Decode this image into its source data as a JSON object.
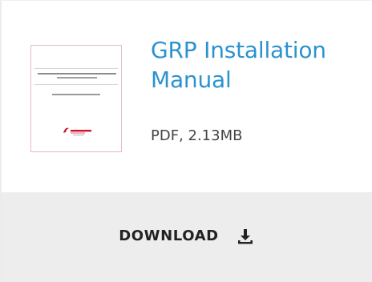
{
  "document": {
    "title": "GRP Installation Manual",
    "meta": "PDF, 2.13MB",
    "thumbnail_brand_color": "#d0102c"
  },
  "download": {
    "label": "DOWNLOAD",
    "icon": "download-icon"
  },
  "colors": {
    "title_link": "#2b93cf",
    "meta_text": "#454545",
    "download_bar": "#ededed",
    "download_text": "#222222",
    "thumbnail_border": "#e8b7c4"
  }
}
